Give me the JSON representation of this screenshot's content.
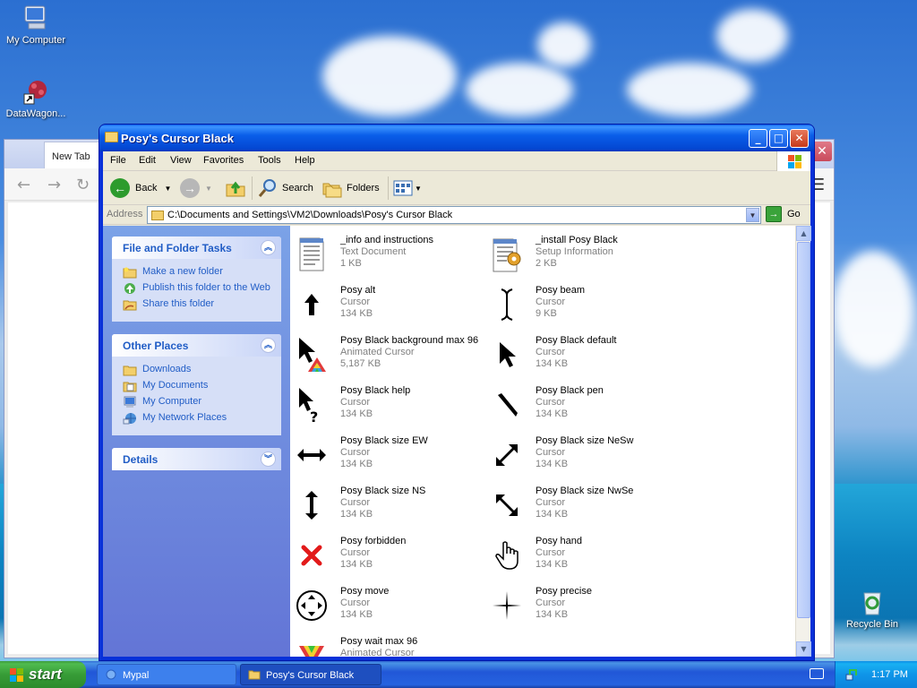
{
  "desktop": {
    "icons": [
      {
        "label": "My Computer"
      },
      {
        "label": "DataWagon..."
      },
      {
        "label": "Recycle Bin"
      }
    ]
  },
  "browser": {
    "tab_label": "New Tab"
  },
  "explorer": {
    "title": "Posy's Cursor Black",
    "menu": [
      "File",
      "Edit",
      "View",
      "Favorites",
      "Tools",
      "Help"
    ],
    "toolbar": {
      "back": "Back",
      "search": "Search",
      "folders": "Folders"
    },
    "address": {
      "label": "Address",
      "value": "C:\\Documents and Settings\\VM2\\Downloads\\Posy's Cursor Black",
      "go": "Go"
    },
    "tasks_panel": {
      "title": "File and Folder Tasks",
      "items": [
        "Make a new folder",
        "Publish this folder to the Web",
        "Share this folder"
      ]
    },
    "places_panel": {
      "title": "Other Places",
      "items": [
        "Downloads",
        "My Documents",
        "My Computer",
        "My Network Places"
      ]
    },
    "details_panel": {
      "title": "Details"
    },
    "files": [
      {
        "name": "_info and instructions",
        "type": "Text Document",
        "size": "1 KB",
        "icon": "text-document-icon"
      },
      {
        "name": "_install Posy Black",
        "type": "Setup Information",
        "size": "2 KB",
        "icon": "setup-information-icon"
      },
      {
        "name": "Posy alt",
        "type": "Cursor",
        "size": "134 KB",
        "icon": "arrow-up-icon"
      },
      {
        "name": "Posy beam",
        "type": "Cursor",
        "size": "9 KB",
        "icon": "text-beam-icon"
      },
      {
        "name": "Posy Black background max 96",
        "type": "Animated Cursor",
        "size": "5,187 KB",
        "icon": "pointer-busy-icon"
      },
      {
        "name": "Posy Black default",
        "type": "Cursor",
        "size": "134 KB",
        "icon": "pointer-icon"
      },
      {
        "name": "Posy Black help",
        "type": "Cursor",
        "size": "134 KB",
        "icon": "pointer-help-icon"
      },
      {
        "name": "Posy Black pen",
        "type": "Cursor",
        "size": "134 KB",
        "icon": "pen-icon"
      },
      {
        "name": "Posy Black size EW",
        "type": "Cursor",
        "size": "134 KB",
        "icon": "resize-ew-icon"
      },
      {
        "name": "Posy Black size NeSw",
        "type": "Cursor",
        "size": "134 KB",
        "icon": "resize-nesw-icon"
      },
      {
        "name": "Posy Black size NS",
        "type": "Cursor",
        "size": "134 KB",
        "icon": "resize-ns-icon"
      },
      {
        "name": "Posy Black size NwSe",
        "type": "Cursor",
        "size": "134 KB",
        "icon": "resize-nwse-icon"
      },
      {
        "name": "Posy forbidden",
        "type": "Cursor",
        "size": "134 KB",
        "icon": "forbidden-icon"
      },
      {
        "name": "Posy hand",
        "type": "Cursor",
        "size": "134 KB",
        "icon": "hand-icon"
      },
      {
        "name": "Posy move",
        "type": "Cursor",
        "size": "134 KB",
        "icon": "move-icon"
      },
      {
        "name": "Posy precise",
        "type": "Cursor",
        "size": "134 KB",
        "icon": "crosshair-icon"
      },
      {
        "name": "Posy wait max 96",
        "type": "Animated Cursor",
        "size": "",
        "icon": "wait-icon"
      }
    ]
  },
  "taskbar": {
    "start": "start",
    "tasks": [
      "Mypal",
      "Posy's Cursor Black"
    ],
    "clock": "1:17 PM"
  }
}
